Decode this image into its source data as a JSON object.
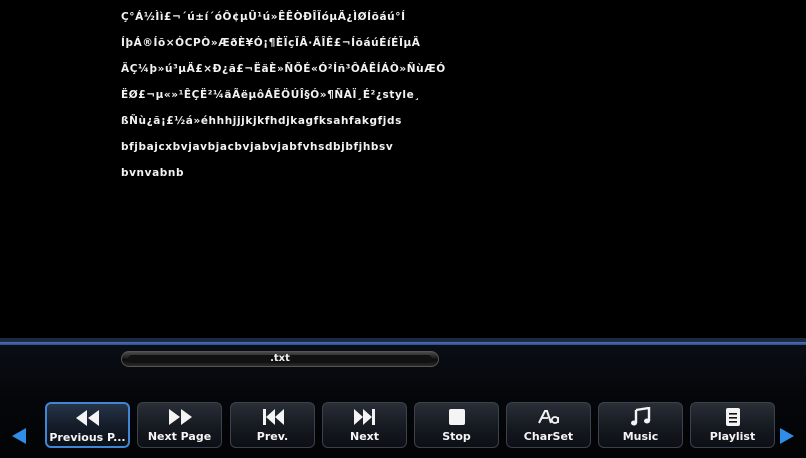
{
  "content": {
    "lines": [
      "Ç°Á½Ìì£¬´ú±í´óÔ¢µÛ¹ú»ÊÊÒÐÎÏóµÄ¿ÌØÍõáú°Í",
      "ÍþÁ®Íõ×ÓCPÒ»ÆðÈ¥Ó¡¶ÈÏçÏÂ·ÃÎÊ£¬ÍõáúÉíÉÏµÄ",
      "ÄÇ¼þ»ú³µÄ£×Ð¿ã£¬ËäÈ»ÑÕÉ«Ó²Íñ³ÔÁÊÍÁÒ»ÑùÆÓ",
      "ËØ£¬µ«»¹ÊÇË²¼äÃëµôÁËÖÚÎ§Ó»¶ÑÀÏ¸É²¿style¸",
      "ßÑù¿ã¡£½á»éhhhjjjkjkfhdjkagfksahfakgfjds",
      "bfjbajcxbvjavbjacbvjabvjabfvhsdbjbfjhbsv",
      "bvnvabnb"
    ]
  },
  "file": {
    "name": ".txt"
  },
  "toolbar": {
    "buttons": [
      {
        "label": "Previous P...",
        "icon": "rewind-icon",
        "selected": true
      },
      {
        "label": "Next Page",
        "icon": "fast-forward-icon",
        "selected": false
      },
      {
        "label": "Prev.",
        "icon": "skip-back-icon",
        "selected": false
      },
      {
        "label": "Next",
        "icon": "skip-forward-icon",
        "selected": false
      },
      {
        "label": "Stop",
        "icon": "stop-icon",
        "selected": false
      },
      {
        "label": "CharSet",
        "icon": "charset-icon",
        "selected": false
      },
      {
        "label": "Music",
        "icon": "music-note-icon",
        "selected": false
      },
      {
        "label": "Playlist",
        "icon": "playlist-icon",
        "selected": false
      }
    ],
    "accent_color": "#2f8de8"
  }
}
